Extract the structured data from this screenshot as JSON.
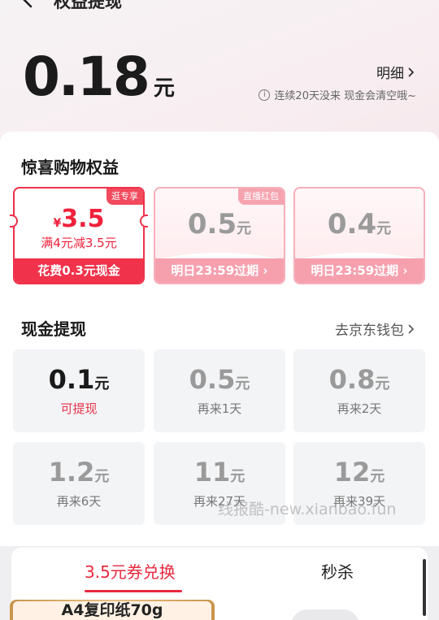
{
  "header": {
    "title": "权益提现"
  },
  "balance": {
    "amount": "0.18",
    "unit": "元"
  },
  "detail_link": "明细",
  "notice": "连续20天没来 现金会清空哦~",
  "benefits": {
    "title": "惊喜购物权益",
    "coupons": [
      {
        "tag": "逛专享",
        "yen": "¥",
        "amount": "3.5",
        "condition": "满4元减3.5元",
        "footer": "花费0.3元现金",
        "state": "active"
      },
      {
        "tag": "直播红包",
        "amount": "0.5",
        "unit": "元",
        "footer": "明日23:59过期",
        "state": "expired"
      },
      {
        "amount": "0.4",
        "unit": "元",
        "footer": "明日23:59过期",
        "state": "expired"
      }
    ]
  },
  "withdraw": {
    "title": "现金提现",
    "wallet_link": "去京东钱包",
    "options": [
      {
        "amount": "0.1",
        "unit": "元",
        "status": "可提现",
        "active": true
      },
      {
        "amount": "0.5",
        "unit": "元",
        "status": "再来1天",
        "active": false
      },
      {
        "amount": "0.8",
        "unit": "元",
        "status": "再来2天",
        "active": false
      },
      {
        "amount": "1.2",
        "unit": "元",
        "status": "再来6天",
        "active": false
      },
      {
        "amount": "11",
        "unit": "元",
        "status": "再来27天",
        "active": false
      },
      {
        "amount": "12",
        "unit": "元",
        "status": "再来39天",
        "active": false
      }
    ]
  },
  "watermark": "线报酷-new.xianbao.fun",
  "tabs": [
    {
      "label": "3.5元券兑换",
      "active": true
    },
    {
      "label": "秒杀",
      "active": false
    }
  ],
  "product": {
    "title": "A4复印纸70g"
  },
  "colors": {
    "accent": "#e8283e",
    "accent_soft": "#f6a0ae",
    "tile_bg": "#f3f4f6"
  }
}
